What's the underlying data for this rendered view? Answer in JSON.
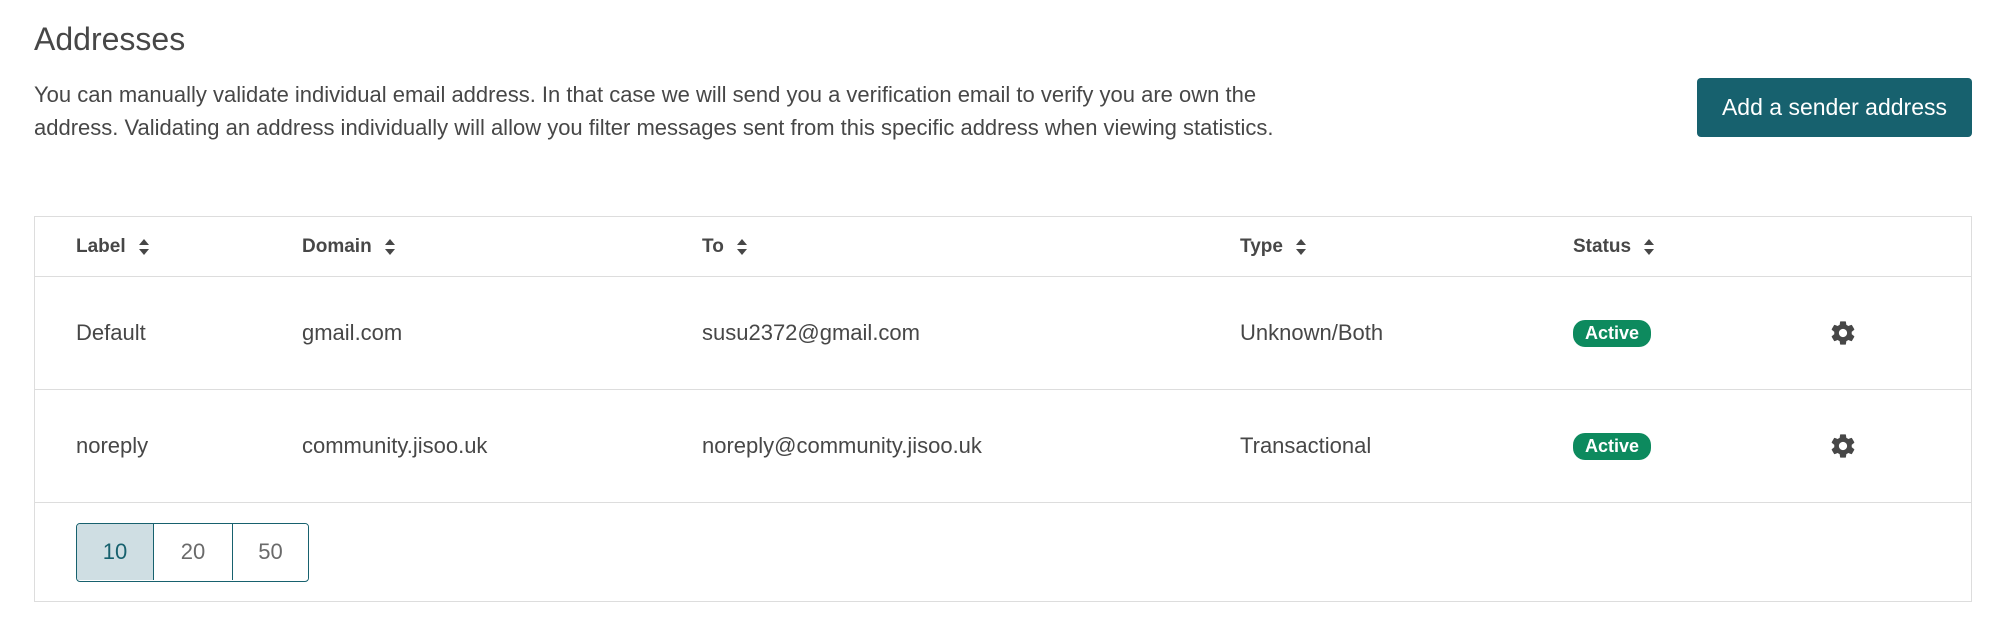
{
  "header": {
    "title": "Addresses",
    "description": "You can manually validate individual email address. In that case we will send you a verification email to verify you are own the address. Validating an address individually will allow you filter messages sent from this specific address when viewing statistics.",
    "add_button_label": "Add a sender address"
  },
  "table": {
    "columns": [
      {
        "label": "Label",
        "icon": "sort-icon"
      },
      {
        "label": "Domain",
        "icon": "sort-icon"
      },
      {
        "label": "To",
        "icon": "sort-icon"
      },
      {
        "label": "Type",
        "icon": "sort-icon"
      },
      {
        "label": "Status",
        "icon": "sort-icon"
      }
    ],
    "rows": [
      {
        "label": "Default",
        "domain": "gmail.com",
        "to": "susu2372@gmail.com",
        "type": "Unknown/Both",
        "status": "Active",
        "action_icon": "gear-icon"
      },
      {
        "label": "noreply",
        "domain": "community.jisoo.uk",
        "to": "noreply@community.jisoo.uk",
        "type": "Transactional",
        "status": "Active",
        "action_icon": "gear-icon"
      }
    ]
  },
  "pagination": {
    "options": [
      "10",
      "20",
      "50"
    ],
    "selected": "10"
  },
  "colors": {
    "accent": "#17616e",
    "status_active": "#0d8a5e",
    "pagination_active_bg": "#cfdee3",
    "border": "#dddddd",
    "text": "#474747"
  }
}
